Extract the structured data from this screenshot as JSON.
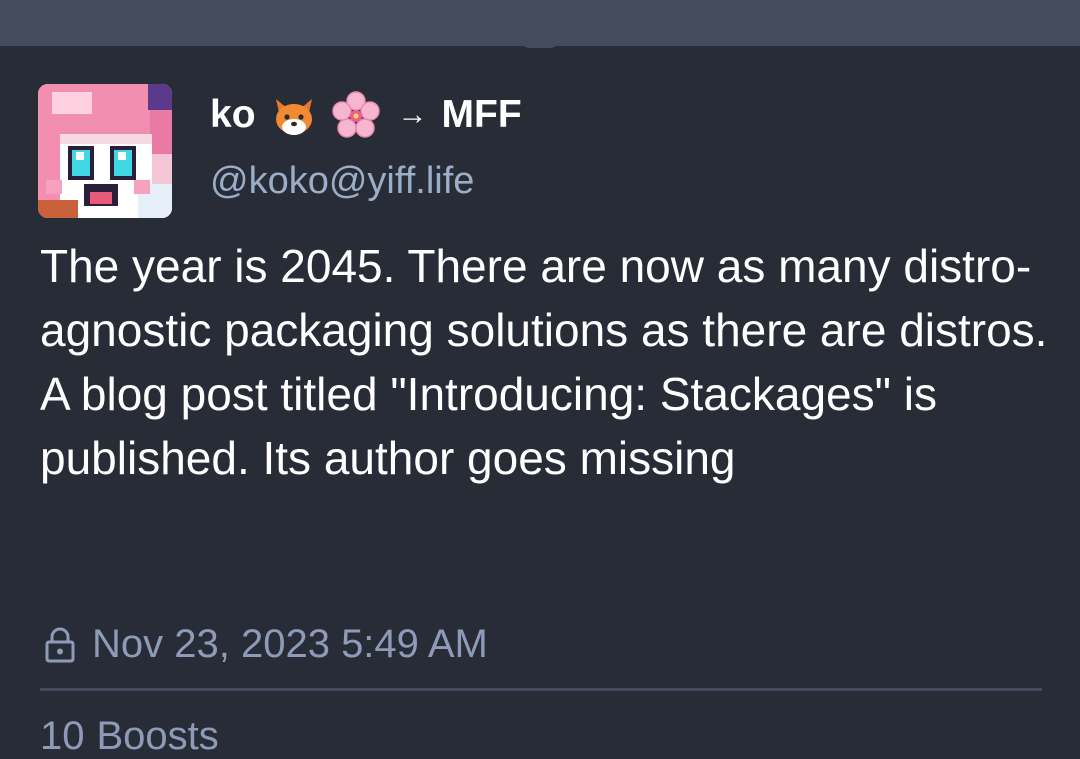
{
  "post": {
    "author": {
      "display_name": "ko",
      "name_emoji": [
        "fox-emoji",
        "cherry-blossom-emoji"
      ],
      "arrow": "→",
      "moved_to": "MFF",
      "handle": "@koko@yiff.life"
    },
    "content": "The year is 2045. There are now as many distro-agnostic packaging solutions as there are distros. A blog post titled \"Introducing: Stackages\" is published. Its author goes missing",
    "timestamp": "Nov 23, 2023 5:49 AM",
    "visibility_icon": "lock-icon",
    "reblogs_count": "10",
    "reblogs_label": "Boosts"
  },
  "colors": {
    "background": "#282c37",
    "topbar": "#444b5d",
    "secondary_text": "#9baec8",
    "meta_text": "#8e9bb8",
    "divider": "#434a5d"
  }
}
